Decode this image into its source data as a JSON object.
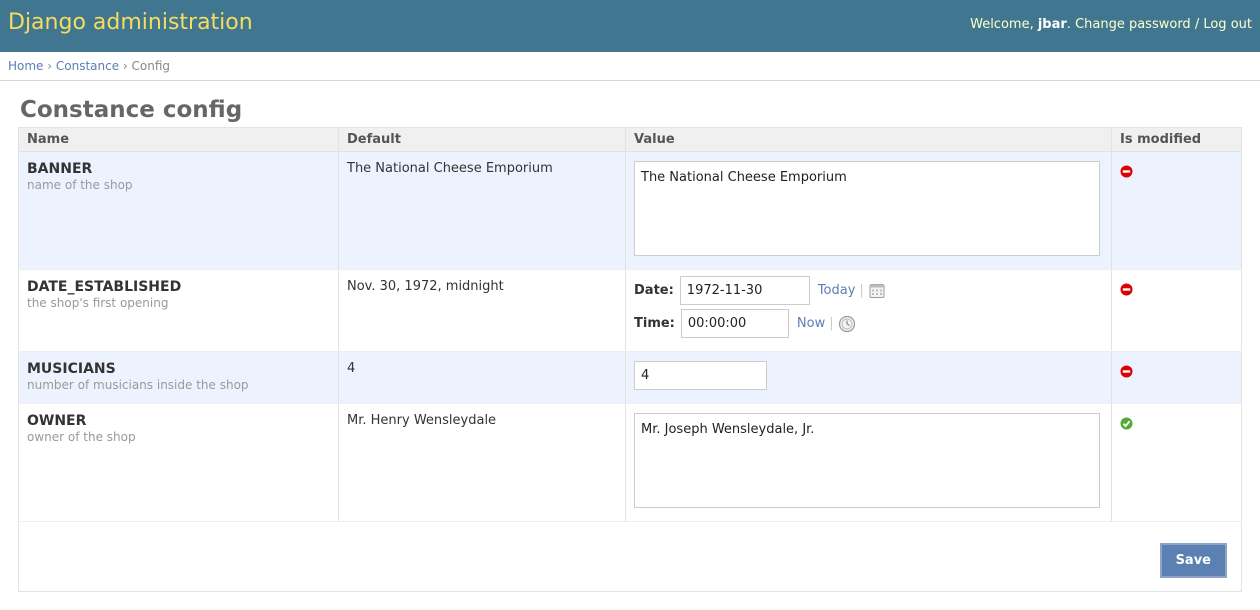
{
  "header": {
    "site_name": "Django administration",
    "welcome": "Welcome, ",
    "username": "jbar",
    "after_user": ". ",
    "change_password": "Change password",
    "separator": " / ",
    "logout": "Log out"
  },
  "breadcrumbs": {
    "home": "Home",
    "sep": " › ",
    "app": "Constance",
    "current": "Config"
  },
  "page_title": "Constance config",
  "table": {
    "columns": [
      "Name",
      "Default",
      "Value",
      "Is modified"
    ],
    "rows": [
      {
        "name": "BANNER",
        "help": "name of the shop",
        "default": "The National Cheese Emporium",
        "value": "The National Cheese Emporium",
        "modified_icon": "no-entry-icon"
      },
      {
        "name": "DATE_ESTABLISHED",
        "help": "the shop's first opening",
        "default": "Nov. 30, 1972, midnight",
        "date_label": "Date:",
        "date_value": "1972-11-30",
        "today": "Today",
        "time_label": "Time:",
        "time_value": "00:00:00",
        "now": "Now",
        "modified_icon": "no-entry-icon"
      },
      {
        "name": "MUSICIANS",
        "help": "number of musicians inside the shop",
        "default": "4",
        "value": "4",
        "modified_icon": "no-entry-icon"
      },
      {
        "name": "OWNER",
        "help": "owner of the shop",
        "default": "Mr. Henry Wensleydale",
        "value": "Mr. Joseph Wensleydale, Jr.",
        "modified_icon": "check-icon"
      }
    ]
  },
  "submit": {
    "save_label": "Save"
  },
  "colors": {
    "header_bg": "#417690",
    "site_name": "#f5dd5d",
    "link": "#5b80b2",
    "row_alt": "#edf3fe",
    "no_entry": "#dd0000",
    "check": "#55aa33"
  }
}
